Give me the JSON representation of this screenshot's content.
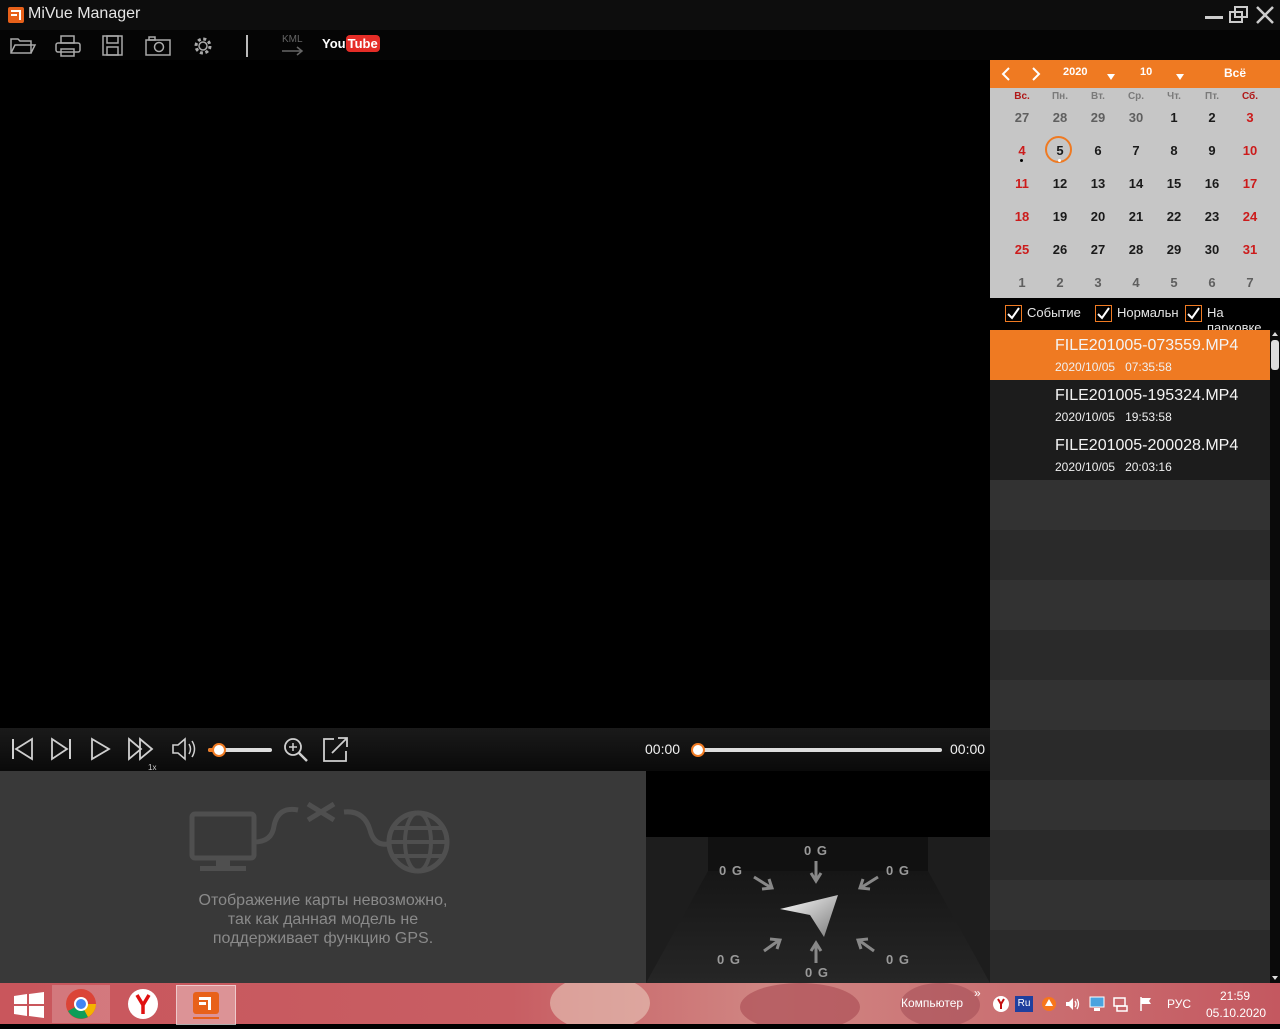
{
  "window": {
    "title": "MiVue Manager"
  },
  "toolbar": {
    "icons": [
      "folder-open-icon",
      "print-icon",
      "save-icon",
      "camera-icon",
      "settings-icon",
      "kml-export-icon",
      "youtube-icon"
    ],
    "kml_label": "KML",
    "youtube_label_you": "You",
    "youtube_label_tube": "Tube"
  },
  "player": {
    "time_current": "00:00",
    "time_total": "00:00",
    "speed_label": "1x",
    "volume_level": 0.15,
    "progress": 0.0
  },
  "map": {
    "message_line1": "Отображение карты невозможно,",
    "message_line2": "так как данная модель не",
    "message_line3": "поддерживает функцию GPS."
  },
  "gsensor": {
    "top": "0 G",
    "top_left": "0 G",
    "top_right": "0 G",
    "bottom": "0 G",
    "bottom_left": "0 G",
    "bottom_right": "0 G"
  },
  "calendar": {
    "year": "2020",
    "month": "10",
    "all_label": "Всё",
    "weekdays": [
      "Вс.",
      "Пн.",
      "Вт.",
      "Ср.",
      "Чт.",
      "Пт.",
      "Сб."
    ],
    "weeks": [
      [
        "27",
        "28",
        "29",
        "30",
        "1",
        "2",
        "3"
      ],
      [
        "4",
        "5",
        "6",
        "7",
        "8",
        "9",
        "10"
      ],
      [
        "11",
        "12",
        "13",
        "14",
        "15",
        "16",
        "17"
      ],
      [
        "18",
        "19",
        "20",
        "21",
        "22",
        "23",
        "24"
      ],
      [
        "25",
        "26",
        "27",
        "28",
        "29",
        "30",
        "31"
      ],
      [
        "1",
        "2",
        "3",
        "4",
        "5",
        "6",
        "7"
      ]
    ],
    "selected_day": "5",
    "accent": "#ef7a22",
    "weekend_color": "#cc1b1b"
  },
  "filters": [
    {
      "label": "Событие",
      "checked": true
    },
    {
      "label": "Нормальн",
      "checked": true
    },
    {
      "label": "На парковке",
      "checked": true
    }
  ],
  "files": [
    {
      "name": "FILE201005-073559.MP4",
      "date": "2020/10/05",
      "time": "07:35:58",
      "selected": true
    },
    {
      "name": "FILE201005-195324.MP4",
      "date": "2020/10/05",
      "time": "19:53:58",
      "selected": false
    },
    {
      "name": "FILE201005-200028.MP4",
      "date": "2020/10/05",
      "time": "20:03:16",
      "selected": false
    }
  ],
  "taskbar": {
    "apps": [
      "windows-start-icon",
      "chrome-icon",
      "yandex-browser-icon",
      "mivue-taskbar-icon"
    ],
    "computer_label": "Компьютер",
    "chevron": "»",
    "lang": "РУС",
    "lang_small": "Ru",
    "clock_time": "21:59",
    "clock_date": "05.10.2020"
  }
}
